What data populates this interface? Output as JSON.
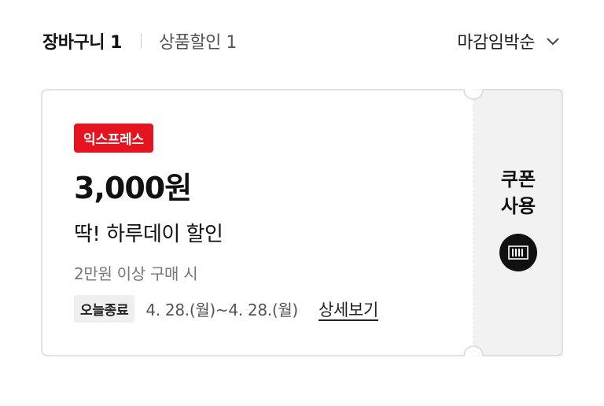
{
  "header": {
    "tab_cart": "장바구니 1",
    "tab_discount": "상품할인 1",
    "sort_label": "마감임박순"
  },
  "coupon": {
    "badge": "익스프레스",
    "amount": "3,000원",
    "title": "딱! 하루데이 할인",
    "condition": "2만원 이상 구매 시",
    "end_tag": "오늘종료",
    "period": "4. 28.(월)~4. 28.(월)",
    "detail_link": "상세보기",
    "use_line1": "쿠폰",
    "use_line2": "사용",
    "barcode_icon": "barcode-icon"
  },
  "colors": {
    "badge_bg": "#e5141e",
    "side_bg": "#f2f2f2",
    "border": "#d9d9d9"
  }
}
